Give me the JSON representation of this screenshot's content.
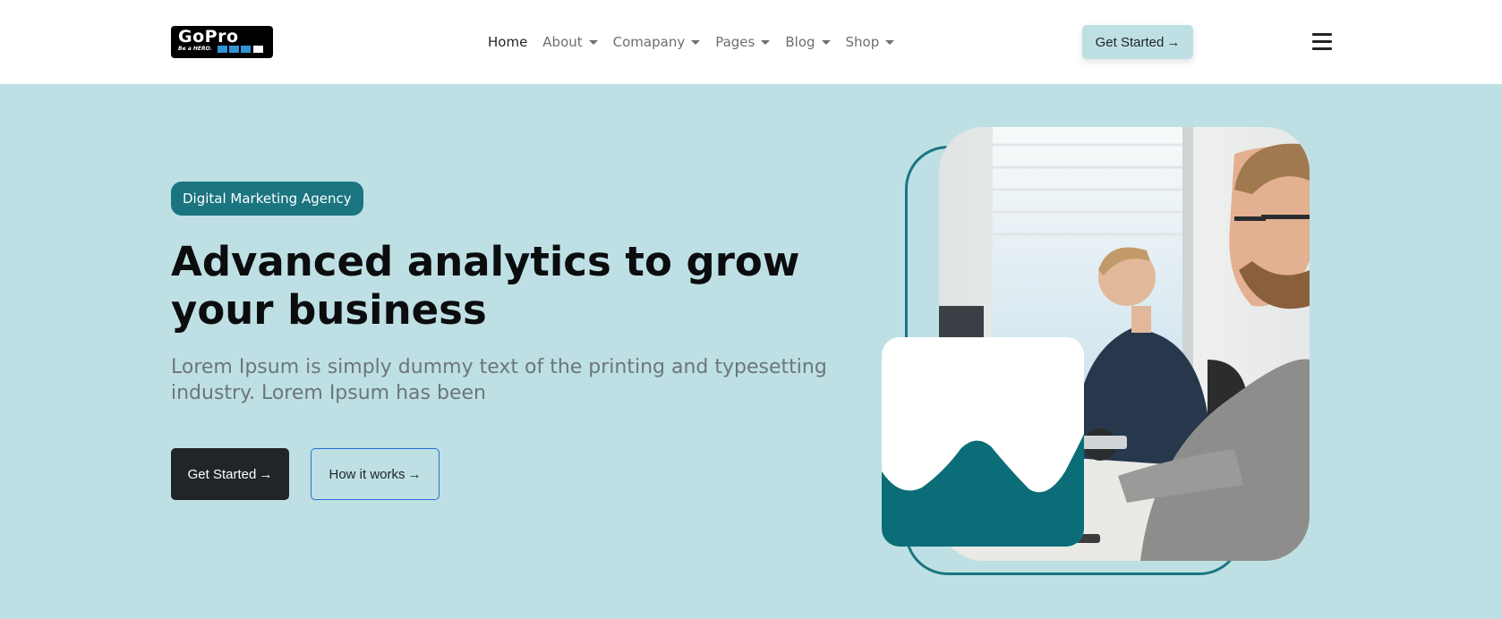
{
  "brand": {
    "logo_text": "GoPro",
    "logo_tagline": "Be a HERO.",
    "colors": {
      "accent": "#1b7580",
      "hero_bg": "#bee0e4",
      "logo_blue": "#2f95d6"
    }
  },
  "nav": {
    "items": [
      {
        "label": "Home",
        "dropdown": false,
        "active": true
      },
      {
        "label": "About",
        "dropdown": true
      },
      {
        "label": "Comapany",
        "dropdown": true
      },
      {
        "label": "Pages",
        "dropdown": true
      },
      {
        "label": "Blog",
        "dropdown": true
      },
      {
        "label": "Shop",
        "dropdown": true
      }
    ],
    "cta_label": "Get Started",
    "menu_icon": "hamburger-icon"
  },
  "hero": {
    "badge": "Digital Marketing Agency",
    "title": "Advanced analytics to grow your business",
    "text": "Lorem Ipsum is simply dummy text of the printing and typesetting industry. Lorem Ipsum has been",
    "primary_button": "Get Started",
    "secondary_button": "How it works",
    "arrow_icon": "arrow-right-icon"
  }
}
